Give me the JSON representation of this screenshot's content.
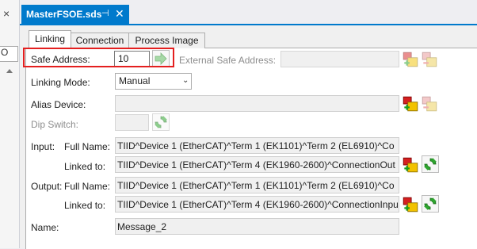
{
  "left": {
    "close_glyph": "×",
    "combo_text": "O"
  },
  "document_tab": {
    "title": "MasterFSOE.sds",
    "pin_glyph": "⊣",
    "close_glyph": "✕"
  },
  "tabs": [
    "Linking",
    "Connection",
    "Process Image"
  ],
  "active_tab": "Linking",
  "form": {
    "safe_address_label": "Safe Address:",
    "safe_address_value": "10",
    "external_safe_address_label": "External Safe Address:",
    "external_safe_address_value": "",
    "linking_mode_label": "Linking Mode:",
    "linking_mode_value": "Manual",
    "alias_device_label": "Alias Device:",
    "alias_device_value": "",
    "dip_switch_label": "Dip Switch:",
    "input_label": "Input:",
    "output_label": "Output:",
    "full_name_label": "Full Name:",
    "linked_to_label": "Linked to:",
    "input_full_name": "TIID^Device 1 (EtherCAT)^Term 1 (EK1101)^Term 2 (EL6910)^Co",
    "input_linked_to": "TIID^Device 1 (EtherCAT)^Term 4 (EK1960-2600)^ConnectionOut",
    "output_full_name": "TIID^Device 1 (EtherCAT)^Term 1 (EK1101)^Term 2 (EL6910)^Co",
    "output_linked_to": "TIID^Device 1 (EtherCAT)^Term 4 (EK1960-2600)^ConnectionInpu",
    "name_label": "Name:",
    "name_value": "Message_2"
  },
  "icons": {
    "accent": "#007acc",
    "highlight": "#e41f1f",
    "link_icon": "link-add-icon",
    "unlink_icon": "link-remove-icon",
    "refresh_icon": "green-refresh-icon"
  }
}
